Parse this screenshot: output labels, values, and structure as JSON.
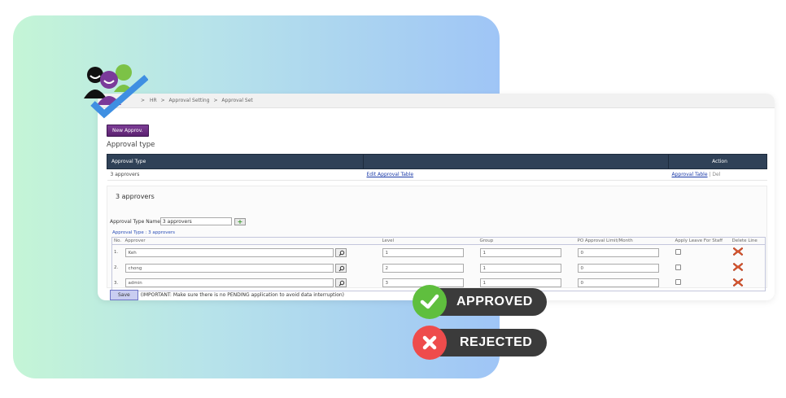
{
  "breadcrumb": {
    "items": [
      "HR",
      "Approval Setting",
      "Approval Set"
    ],
    "sep": ">"
  },
  "toolbar": {
    "new_label": "New Approv."
  },
  "section": {
    "title": "Approval type"
  },
  "types_table": {
    "headers": {
      "type": "Approval Type",
      "middle": "",
      "action": "Action"
    },
    "row": {
      "type": "3 approvers",
      "edit_link": "Edit Approval Table",
      "approval_link": "Approval Table",
      "sep": "|",
      "del": "Del"
    }
  },
  "detail": {
    "heading": "3 approvers",
    "name_label": "Approval Type Name",
    "name_value": "3 approvers",
    "plus_label": "+",
    "type_link": "Approval Type : 3 approvers"
  },
  "approvers_table": {
    "headers": [
      "No.",
      "Approver",
      "Level",
      "Group",
      "PO Approval Limit/Month",
      "Apply Leave For Staff",
      "Delete Line"
    ],
    "rows": [
      {
        "no": "1.",
        "approver": "Keh",
        "level": "1",
        "group": "1",
        "limit": "0"
      },
      {
        "no": "2.",
        "approver": "chong",
        "level": "2",
        "group": "1",
        "limit": "0"
      },
      {
        "no": "3.",
        "approver": "admin",
        "level": "3",
        "group": "1",
        "limit": "0"
      }
    ]
  },
  "footer": {
    "save_label": "Save",
    "notice": "(IMPORTANT: Make sure there is no PENDING application to avoid data interruption)"
  },
  "badges": {
    "approved": {
      "label": "APPROVED",
      "color": "#5fbf3e"
    },
    "rejected": {
      "label": "REJECTED",
      "color": "#ee4c4c"
    }
  },
  "colors": {
    "header_bg": "#2f4157",
    "accent_purple": "#6b2d84",
    "badge_bg": "#3b3b3b"
  }
}
